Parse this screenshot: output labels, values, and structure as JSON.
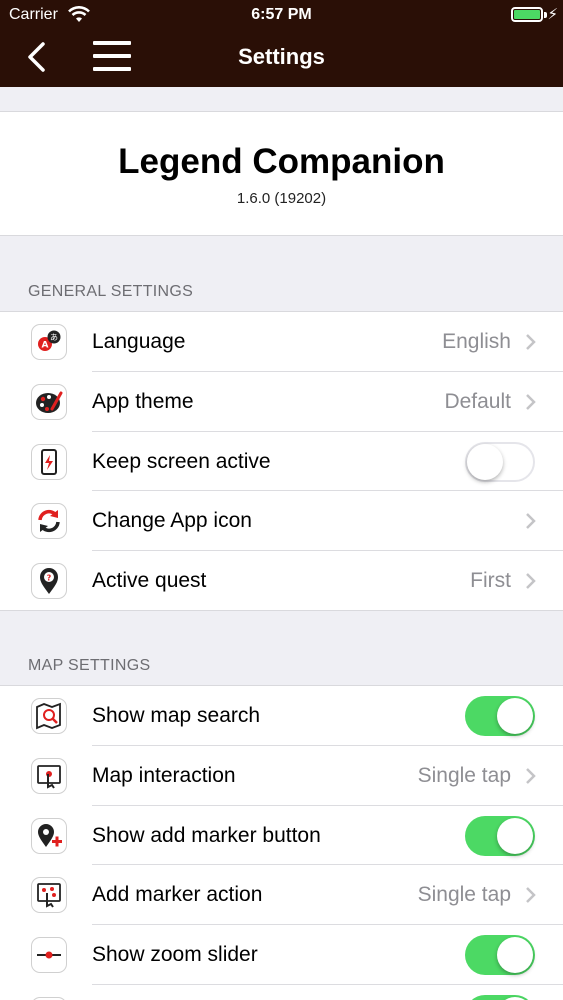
{
  "status_bar": {
    "carrier": "Carrier",
    "time": "6:57 PM",
    "battery_level_percent": 100
  },
  "nav": {
    "title": "Settings",
    "back_icon": "chevron-left-icon",
    "menu_icon": "hamburger-menu-icon"
  },
  "app": {
    "name": "Legend Companion",
    "version": "1.6.0 (19202)"
  },
  "general": {
    "title": "GENERAL SETTINGS",
    "items": [
      {
        "label": "Language",
        "value": "English",
        "icon": "language-icon"
      },
      {
        "label": "App theme",
        "value": "Default",
        "icon": "palette-icon"
      },
      {
        "label": "Keep screen active",
        "toggle": false,
        "icon": "phone-bolt-icon"
      },
      {
        "label": "Change App icon",
        "icon": "refresh-icon"
      },
      {
        "label": "Active quest",
        "value": "First",
        "icon": "quest-pin-icon"
      }
    ]
  },
  "map": {
    "title": "MAP SETTINGS",
    "items": [
      {
        "label": "Show map search",
        "toggle": true,
        "icon": "map-search-icon"
      },
      {
        "label": "Map interaction",
        "value": "Single tap",
        "icon": "tap-icon"
      },
      {
        "label": "Show add marker button",
        "toggle": true,
        "icon": "add-marker-icon"
      },
      {
        "label": "Add marker action",
        "value": "Single tap",
        "icon": "marker-tap-icon"
      },
      {
        "label": "Show zoom slider",
        "toggle": true,
        "icon": "zoom-slider-icon"
      }
    ]
  },
  "colors": {
    "nav_bg": "#2a0f06",
    "toggle_on": "#4cd964",
    "accent_red": "#e0201f"
  }
}
